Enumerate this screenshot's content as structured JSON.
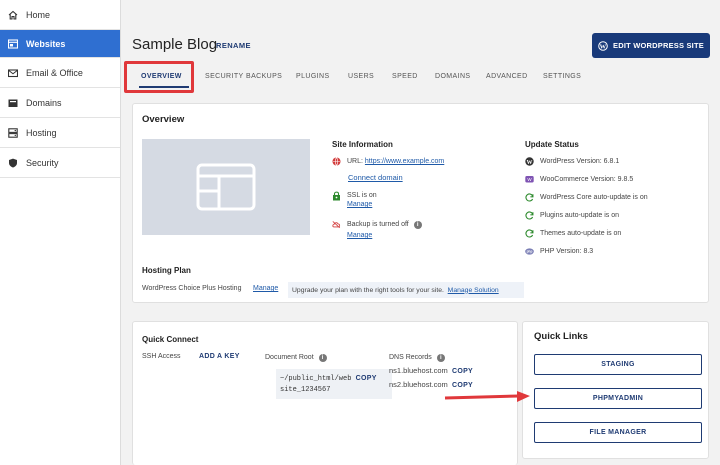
{
  "sidebar": {
    "items": [
      {
        "label": "Home",
        "icon": "home-icon"
      },
      {
        "label": "Websites",
        "icon": "websites-icon"
      },
      {
        "label": "Email & Office",
        "icon": "email-icon"
      },
      {
        "label": "Domains",
        "icon": "domains-icon"
      },
      {
        "label": "Hosting",
        "icon": "hosting-icon"
      },
      {
        "label": "Security",
        "icon": "shield-icon"
      }
    ]
  },
  "header": {
    "site_title": "Sample Blog",
    "rename_label": "RENAME",
    "edit_button": "EDIT WORDPRESS SITE"
  },
  "tabs": [
    "OVERVIEW",
    "SECURITY",
    "BACKUPS",
    "PLUGINS",
    "USERS",
    "SPEED",
    "DOMAINS",
    "ADVANCED",
    "SETTINGS"
  ],
  "overview": {
    "title": "Overview",
    "site_info": {
      "title": "Site Information",
      "url_label": "URL:",
      "url": "https://www.example.com",
      "connect_domain": "Connect domain",
      "ssl_text": "SSL is on",
      "ssl_manage": "Manage",
      "backup_text": "Backup is turned off",
      "backup_manage": "Manage"
    },
    "update_status": {
      "title": "Update Status",
      "items": [
        "WordPress Version: 6.8.1",
        "WooCommerce Version: 9.8.5",
        "WordPress Core auto-update is on",
        "Plugins auto-update is on",
        "Themes auto-update is on",
        "PHP Version: 8.3"
      ]
    },
    "hosting_plan": {
      "title": "Hosting Plan",
      "plan": "WordPress Choice Plus Hosting",
      "manage": "Manage",
      "upgrade_text": "Upgrade your plan with the right tools for your site.",
      "manage_solution": "Manage Solution"
    }
  },
  "quick_connect": {
    "title": "Quick Connect",
    "ssh_label": "SSH Access",
    "add_key": "ADD A KEY",
    "doc_root_label": "Document Root",
    "doc_root_line1": "~/public_html/web",
    "doc_root_line2": "site_1234567",
    "dns_label": "DNS Records",
    "ns1": "ns1.bluehost.com",
    "ns2": "ns2.bluehost.com",
    "copy": "COPY"
  },
  "quick_links": {
    "title": "Quick Links",
    "buttons": [
      "STAGING",
      "PHPMYADMIN",
      "FILE MANAGER"
    ]
  },
  "colors": {
    "accent": "#2f6fd1",
    "primary_dark": "#193a7a",
    "highlight_red": "#e0383b"
  }
}
